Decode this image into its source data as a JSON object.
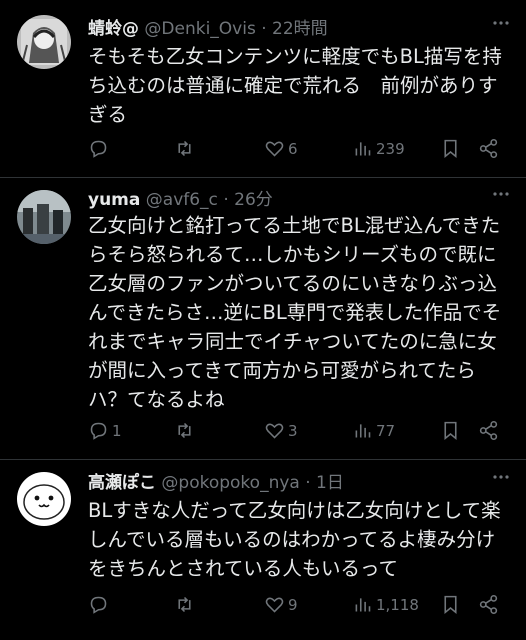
{
  "tweets": [
    {
      "name": "蜻蛉@",
      "handle": "@Denki_Ovis",
      "time": "22時間",
      "text": "そもそも乙女コンテンツに軽度でもBL描写を持ち込むのは普通に確定で荒れる　前例がありすぎる",
      "replies": "",
      "retweets": "",
      "likes": "6",
      "views": "239"
    },
    {
      "name": "yuma",
      "handle": "@avf6_c",
      "time": "26分",
      "text": "乙女向けと銘打ってる土地でBL混ぜ込んできたらそら怒られるて…しかもシリーズもので既に乙女層のファンがついてるのにいきなりぶっ込んできたらさ…逆にBL専門で発表した作品でそれまでキャラ同士でイチャついてたのに急に女が間に入ってきて両方から可愛がられてたらハ？てなるよね",
      "replies": "1",
      "retweets": "",
      "likes": "3",
      "views": "77"
    },
    {
      "name": "高瀬ぽこ",
      "handle": "@pokopoko_nya",
      "time": "1日",
      "text": "BLすきな人だって乙女向けは乙女向けとして楽しんでいる層もいるのはわかってるよ棲み分けをきちんとされている人もいるって",
      "replies": "",
      "retweets": "",
      "likes": "9",
      "views": "1,118"
    }
  ],
  "separator": "·",
  "icons": [
    "reply-icon",
    "retweet-icon",
    "like-icon",
    "views-icon",
    "bookmark-icon",
    "share-icon",
    "more-icon"
  ]
}
